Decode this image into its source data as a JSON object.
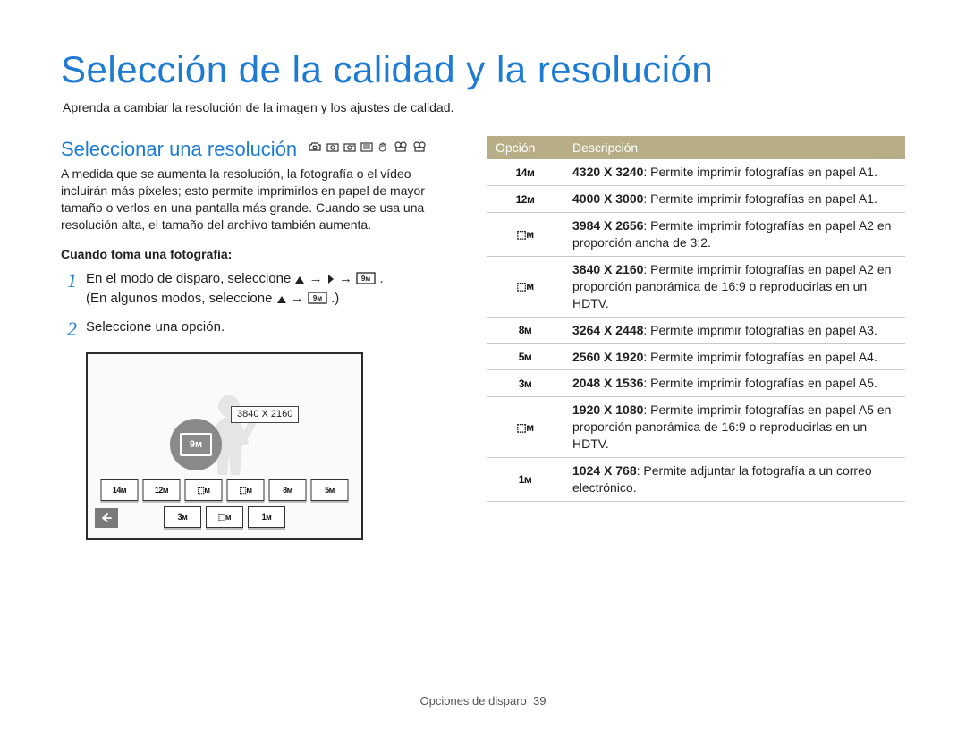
{
  "header": {
    "title": "Selección de la calidad y la resolución",
    "subtitle": "Aprenda a cambiar la resolución de la imagen y los ajustes de calidad."
  },
  "left": {
    "section_title": "Seleccionar una resolución",
    "paragraph": "A medida que se aumenta la resolución, la fotografía o el vídeo incluirán más píxeles; esto permite imprimirlos en papel de mayor tamaño o verlos en una pantalla más grande. Cuando se usa una resolución alta, el tamaño del archivo también aumenta.",
    "subheading": "Cuando toma una fotografía:",
    "steps": [
      {
        "num": "1",
        "text_a": "En el modo de disparo, seleccione ",
        "text_b": " → ",
        "text_c": " → ",
        "text_d": ".",
        "text_paren_a": "(En algunos modos, seleccione ",
        "text_paren_b": "→ ",
        "text_paren_c": ".)"
      },
      {
        "num": "2",
        "text_a": "Seleccione una opción."
      }
    ],
    "lcd": {
      "tooltip": "3840 X 2160",
      "selected_label": "9ᴍ",
      "chips_top": [
        "14ᴍ",
        "12ᴍ",
        "⬚ᴍ",
        "⬚ᴍ",
        "8ᴍ",
        "5ᴍ"
      ],
      "chips_bottom": [
        "3ᴍ",
        "⬚ᴍ",
        "1ᴍ"
      ]
    }
  },
  "right": {
    "table_header_option": "Opción",
    "table_header_desc": "Descripción",
    "rows": [
      {
        "icon": "14ᴍ",
        "res": "4320 X 3240",
        "desc": ": Permite imprimir fotografías en papel A1."
      },
      {
        "icon": "12ᴍ",
        "res": "4000 X 3000",
        "desc": ": Permite imprimir fotografías en papel A1."
      },
      {
        "icon": "⬚ᴍ",
        "res": "3984 X 2656",
        "desc": ": Permite imprimir fotografías en papel A2 en proporción ancha de 3:2."
      },
      {
        "icon": "⬚ᴍ",
        "res": "3840 X 2160",
        "desc": ": Permite imprimir fotografías en papel A2 en proporción panorámica de 16:9 o reproducirlas en un HDTV."
      },
      {
        "icon": "8ᴍ",
        "res": "3264 X 2448",
        "desc": ": Permite imprimir fotografías en papel A3."
      },
      {
        "icon": "5ᴍ",
        "res": "2560 X 1920",
        "desc": ": Permite imprimir fotografías en papel A4."
      },
      {
        "icon": "3ᴍ",
        "res": "2048 X 1536",
        "desc": ": Permite imprimir fotografías en papel A5."
      },
      {
        "icon": "⬚ᴍ",
        "res": "1920 X 1080",
        "desc": ": Permite imprimir fotografías en papel A5 en proporción panorámica de 16:9 o reproducirlas en un HDTV."
      },
      {
        "icon": "1ᴍ",
        "res": "1024 X 768",
        "desc": ": Permite adjuntar la fotografía a un correo electrónico."
      }
    ]
  },
  "footer": {
    "section": "Opciones de disparo",
    "page_num": "39"
  }
}
